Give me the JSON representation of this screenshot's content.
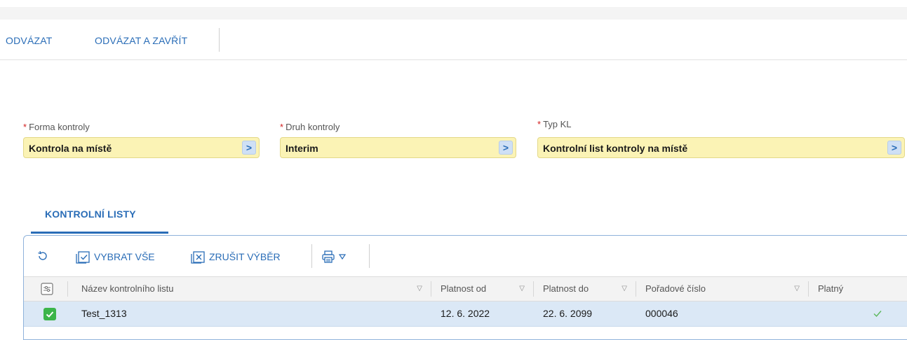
{
  "toolbar": {
    "unbind_label": "ODVÁZAT",
    "unbind_close_label": "ODVÁZAT A ZAVŘÍT"
  },
  "form": {
    "forma": {
      "label": "Forma kontroly",
      "value": "Kontrola na místě",
      "required_mark": "*"
    },
    "druh": {
      "label": "Druh kontroly",
      "value": "Interim",
      "required_mark": "*"
    },
    "typ": {
      "label": "Typ KL",
      "value": "Kontrolní list kontroly na místě",
      "required_mark": "*"
    },
    "arrow_glyph": ">"
  },
  "tab": {
    "label": "KONTROLNÍ LISTY"
  },
  "grid_toolbar": {
    "select_all_label": "VYBRAT VŠE",
    "deselect_label": "ZRUŠIT VÝBĚR",
    "icons": [
      "refresh-icon",
      "select-all-icon",
      "deselect-icon",
      "print-icon",
      "dropdown-arrow-icon"
    ]
  },
  "table": {
    "columns": [
      {
        "label": "Název kontrolního listu"
      },
      {
        "label": "Platnost od"
      },
      {
        "label": "Platnost do"
      },
      {
        "label": "Pořadové číslo"
      },
      {
        "label": "Platný"
      }
    ],
    "rows": [
      {
        "selected": true,
        "name": "Test_1313",
        "valid_from": "12. 6. 2022",
        "valid_to": "22. 6. 2099",
        "order_no": "000046",
        "valid": true
      }
    ]
  },
  "colors": {
    "accent": "#2a6db7",
    "required_field_bg": "#fbf3b5",
    "selected_row_bg": "#dbe8f6",
    "checkbox_green": "#3cb54a",
    "required_mark": "#d21f1f"
  }
}
